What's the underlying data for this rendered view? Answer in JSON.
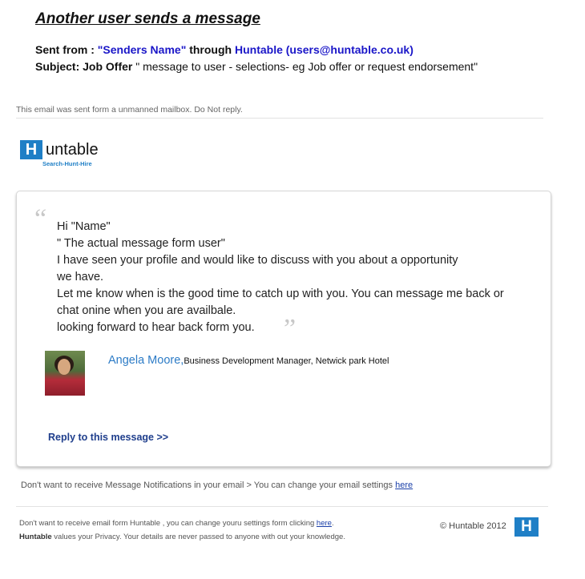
{
  "heading": "Another user sends a message",
  "meta": {
    "sent_prefix": "Sent from : ",
    "sender_quoted": "\"Senders Name\"",
    "through": " through ",
    "brand_email": "Huntable (users@huntable.co.uk)",
    "subject_label": "Subject:  Job Offer",
    "subject_rest": " \" message to user - selections- eg Job offer or request endorsement\""
  },
  "disclaimer": "This email was sent form a unmanned mailbox. Do Not reply.",
  "logo": {
    "letter": "H",
    "text": "untable",
    "tagline": "Search-Hunt-Hire"
  },
  "card": {
    "open_quote": "“",
    "close_quote": "”",
    "lines": [
      "Hi \"Name\"",
      "\" The actual message form user\"",
      "I have seen your profile and would like to discuss with you about a opportunity",
      "we have.",
      "Let me know when is the good time to catch up with you. You can message me back or",
      "chat onine when you are availbale.",
      "looking forward to hear back form you."
    ],
    "sender_name": "Angela Moore,",
    "sender_role": "Business Development Manager, Netwick park Hotel",
    "reply_label": "Reply to this message >>"
  },
  "notification": {
    "text": "Don't want to receive Message Notifications in your email >  You can change your email settings ",
    "link": "here"
  },
  "footer": {
    "line1_text": "Don't want to receive email form Huntable , you can change youru settings form clicking ",
    "line1_link": "here",
    "line1_end": ".",
    "line2_brand": "Huntable",
    "line2_rest": " values your Privacy. Your details are never passed to anyone with out your knowledge.",
    "copyright": "© Huntable 2012",
    "logo_letter": "H"
  },
  "colors": {
    "brand_blue": "#1f7fc6",
    "link_blue": "#1a3fa8",
    "sender_blue": "#1a16c8"
  }
}
